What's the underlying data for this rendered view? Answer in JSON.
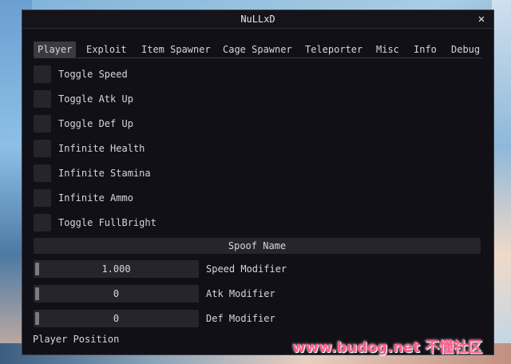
{
  "window": {
    "title": "NuLLxD",
    "close_glyph": "✕"
  },
  "tabs": [
    {
      "label": "Player",
      "active": true
    },
    {
      "label": "Exploit"
    },
    {
      "label": "Item Spawner"
    },
    {
      "label": "Cage Spawner"
    },
    {
      "label": "Teleporter"
    },
    {
      "label": "Misc"
    },
    {
      "label": "Info"
    },
    {
      "label": "Debug"
    }
  ],
  "toggles": [
    {
      "label": "Toggle Speed",
      "checked": false
    },
    {
      "label": "Toggle Atk Up",
      "checked": false
    },
    {
      "label": "Toggle Def Up",
      "checked": false
    },
    {
      "label": "Infinite Health",
      "checked": false
    },
    {
      "label": "Infinite Stamina",
      "checked": false
    },
    {
      "label": "Infinite Ammo",
      "checked": false
    },
    {
      "label": "Toggle FullBright",
      "checked": false
    }
  ],
  "spoof_button": "Spoof Name",
  "sliders": [
    {
      "value": "1.000",
      "label": "Speed Modifier"
    },
    {
      "value": "0",
      "label": "Atk Modifier"
    },
    {
      "value": "0",
      "label": "Def Modifier"
    }
  ],
  "player_position_label": "Player Position",
  "watermark": "www.budog.net 不懂社区",
  "colors": {
    "window_bg": "#111016",
    "widget_bg": "#26252c",
    "active_tab": "#3a3a42",
    "watermark": "#ff5c8a"
  }
}
